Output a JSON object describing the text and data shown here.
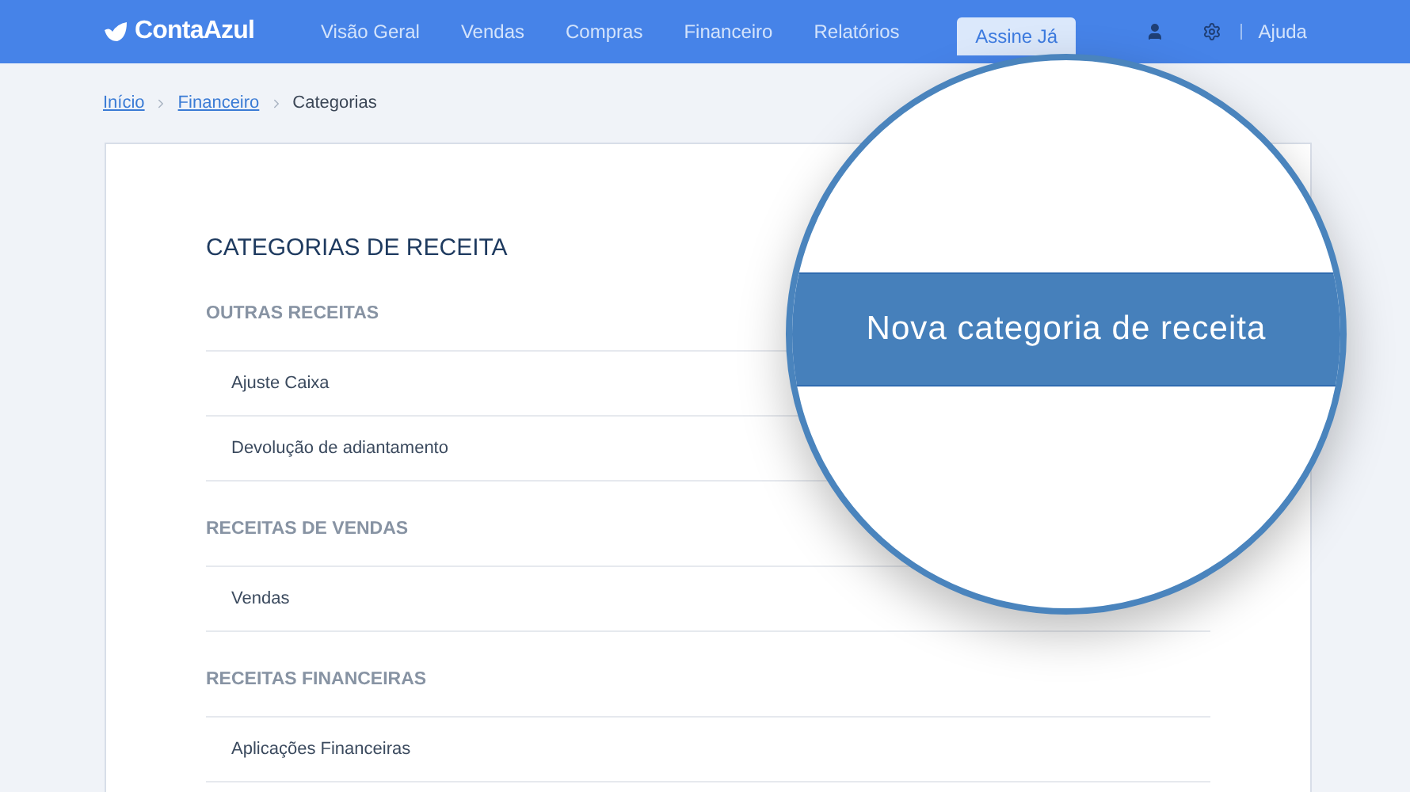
{
  "brand": {
    "name": "ContaAzul"
  },
  "nav": [
    {
      "label": "Visão Geral"
    },
    {
      "label": "Vendas"
    },
    {
      "label": "Compras"
    },
    {
      "label": "Financeiro"
    },
    {
      "label": "Relatórios"
    }
  ],
  "cta": {
    "label": "Assine Já"
  },
  "help": {
    "label": "Ajuda"
  },
  "breadcrumb": [
    {
      "label": "Início",
      "kind": "link"
    },
    {
      "label": "Financeiro",
      "kind": "link"
    },
    {
      "label": "Categorias",
      "kind": "current"
    }
  ],
  "page_title": "CATEGORIAS DE RECEITA",
  "groups": [
    {
      "title": "OUTRAS RECEITAS",
      "items": [
        "Ajuste Caixa",
        "Devolução de adiantamento"
      ]
    },
    {
      "title": "RECEITAS DE VENDAS",
      "items": [
        "Vendas"
      ]
    },
    {
      "title": "RECEITAS FINANCEIRAS",
      "items": [
        "Aplicações Financeiras"
      ]
    }
  ],
  "magnifier": {
    "button": "Nova categoria de receita"
  }
}
